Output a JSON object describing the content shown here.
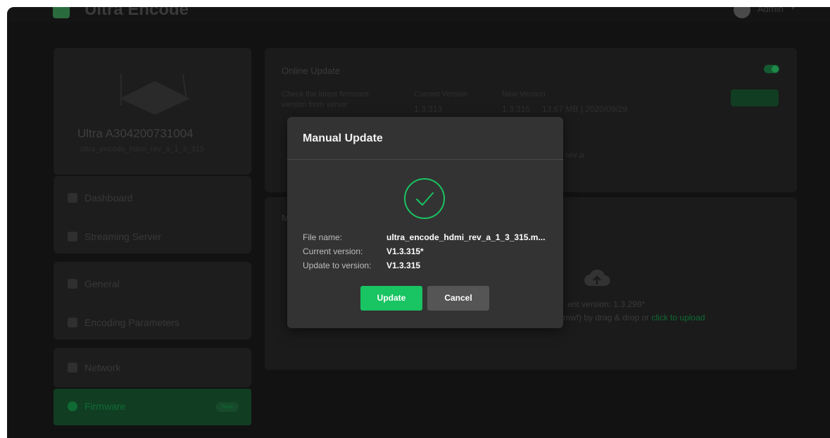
{
  "app": {
    "title": "Ultra Encode",
    "user": "Admin"
  },
  "device": {
    "name": "Ultra A304200731004",
    "subtitle": "ultra_encode_hdmi_rev_a_1_3_315"
  },
  "sidebar": {
    "items": [
      {
        "label": "Dashboard"
      },
      {
        "label": "Streaming Server"
      },
      {
        "label": "General"
      },
      {
        "label": "Encoding Parameters"
      },
      {
        "label": "Network"
      },
      {
        "label": "Firmware",
        "badge": "New",
        "active": true
      }
    ]
  },
  "online_update": {
    "title": "Online Update",
    "description_line1": "Check the latest firmware",
    "description_line2": "version from server",
    "current_version_label": "Current Version",
    "current_version": "1.3.313",
    "new_version_label": "New Version",
    "new_version": "1.3.315",
    "new_version_meta": "13.67 MB | 2020/09/29",
    "note": "rev a"
  },
  "manual_card": {
    "title": "M",
    "current_version_text": "ent version: 1.3.298*",
    "upload_text": "mwf) by drag & drop or ",
    "upload_link": "click to upload"
  },
  "modal": {
    "title": "Manual Update",
    "file_name_label": "File name:",
    "file_name_value": "ultra_encode_hdmi_rev_a_1_3_315.m...",
    "current_version_label": "Current version:",
    "current_version_value": "V1.3.315*",
    "update_to_label": "Update to version:",
    "update_to_value": "V1.3.315",
    "update_button": "Update",
    "cancel_button": "Cancel"
  },
  "colors": {
    "accent": "#19c462",
    "modal_bg": "#333333",
    "page_bg": "#121212"
  }
}
